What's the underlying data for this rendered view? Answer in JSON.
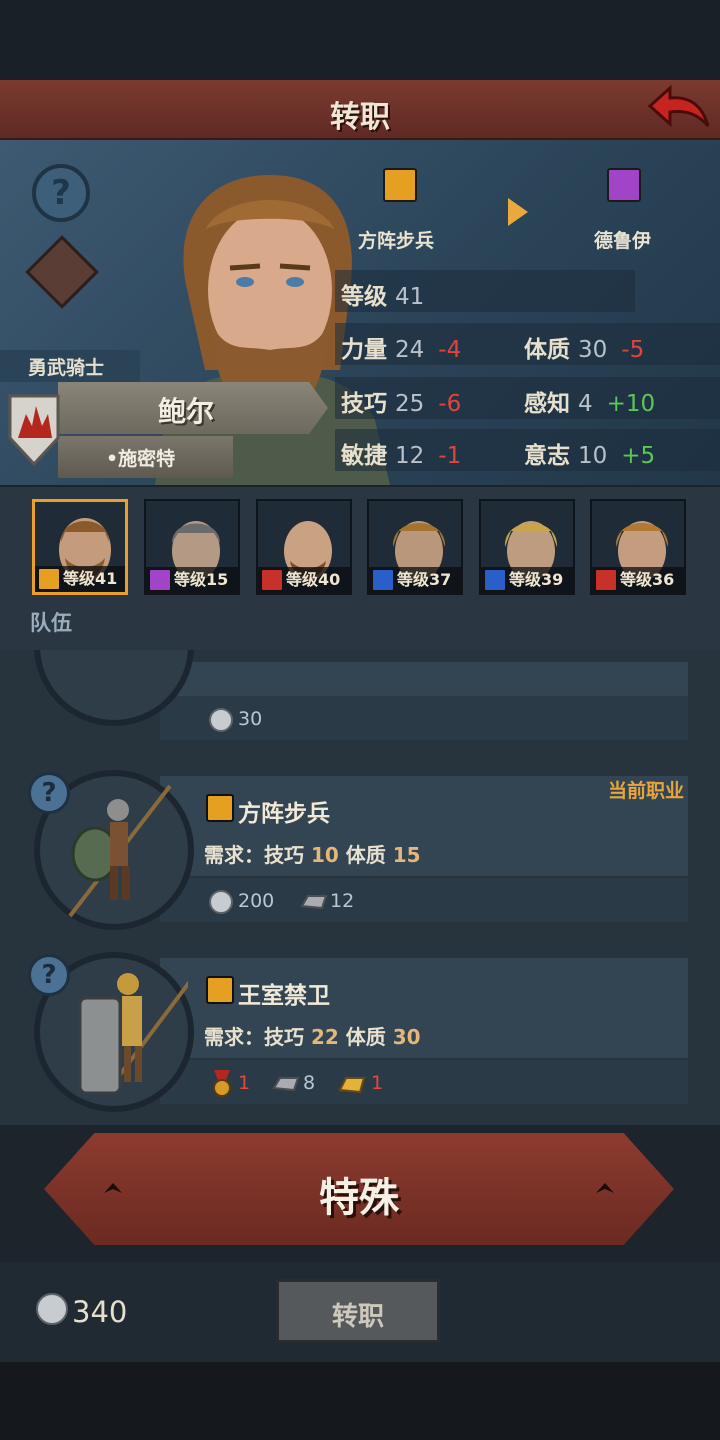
{
  "header": {
    "title": "转职",
    "back_icon": "back-arrow-icon"
  },
  "hero": {
    "title_tag": "勇武骑士",
    "name": "鲍尔",
    "origin": "•施密特",
    "current_class": {
      "label": "方阵步兵",
      "icon": "shield-icon",
      "color": "#e5a021"
    },
    "target_class": {
      "label": "德鲁伊",
      "icon": "staff-icon",
      "color": "#a244c8"
    },
    "stats": {
      "level": {
        "label": "等级",
        "value": "41"
      },
      "strength": {
        "label": "力量",
        "value": "24",
        "delta": "-4"
      },
      "constitution": {
        "label": "体质",
        "value": "30",
        "delta": "-5"
      },
      "skill": {
        "label": "技巧",
        "value": "25",
        "delta": "-6"
      },
      "perception": {
        "label": "感知",
        "value": "4",
        "delta": "+10"
      },
      "agility": {
        "label": "敏捷",
        "value": "12",
        "delta": "-1"
      },
      "will": {
        "label": "意志",
        "value": "10",
        "delta": "+5"
      }
    }
  },
  "team": {
    "label": "队伍",
    "members": [
      {
        "level_text": "等级41",
        "icon": "shield-icon",
        "color": "#e5a021",
        "selected": true
      },
      {
        "level_text": "等级15",
        "icon": "staff-icon",
        "color": "#a244c8",
        "selected": false
      },
      {
        "level_text": "等级40",
        "icon": "horse-icon",
        "color": "#c8302a",
        "selected": false
      },
      {
        "level_text": "等级37",
        "icon": "sword-icon",
        "color": "#2b5fc8",
        "selected": false
      },
      {
        "level_text": "等级39",
        "icon": "sword-icon",
        "color": "#2b5fc8",
        "selected": false
      },
      {
        "level_text": "等级36",
        "icon": "horse-icon",
        "color": "#c8302a",
        "selected": false
      }
    ]
  },
  "classes": [
    {
      "cost_silver": "30"
    },
    {
      "name": "方阵步兵",
      "current_tag": "当前职业",
      "req_label": "需求：",
      "req": [
        {
          "stat": "技巧",
          "value": "10"
        },
        {
          "stat": "体质",
          "value": "15"
        }
      ],
      "cost_silver": "200",
      "cost_iron": "12"
    },
    {
      "name": "王室禁卫",
      "req_label": "需求：",
      "req": [
        {
          "stat": "技巧",
          "value": "22"
        },
        {
          "stat": "体质",
          "value": "30"
        }
      ],
      "cost_medal": "1",
      "cost_iron": "8",
      "cost_gold": "1"
    }
  ],
  "special_button": "特殊",
  "footer": {
    "silver": "340",
    "change_button": "转职"
  }
}
